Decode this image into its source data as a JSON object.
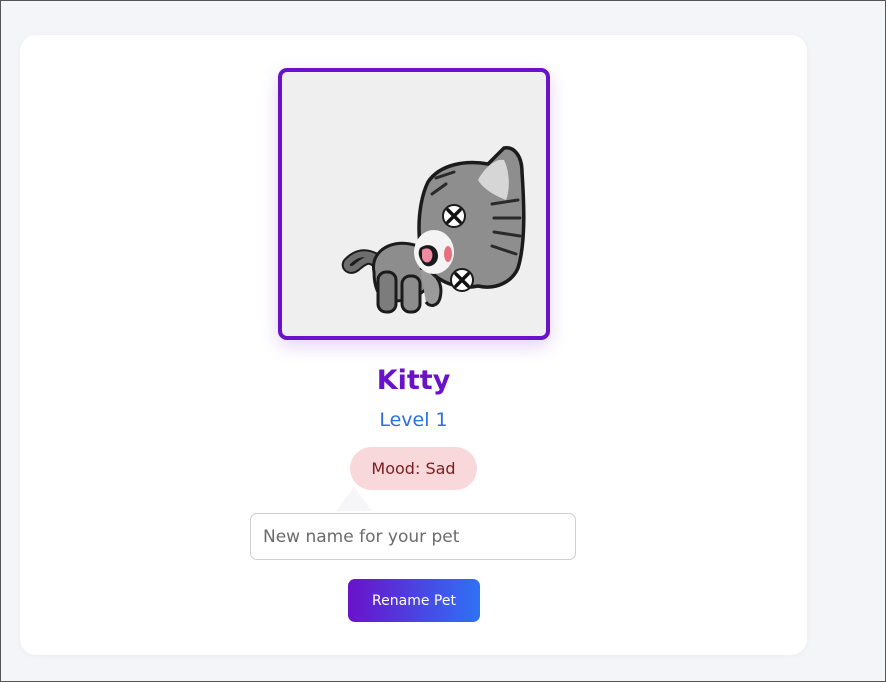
{
  "pet": {
    "name": "Kitty",
    "level": "Level 1",
    "mood": "Mood: Sad",
    "image": "sad-cat-icon"
  },
  "rename": {
    "placeholder": "New name for your pet",
    "value": "",
    "button_label": "Rename Pet"
  },
  "colors": {
    "accent": "#6a12c9",
    "level": "#2f6fe0",
    "mood_bg": "#f9d8dc",
    "mood_text": "#7a1d1d",
    "button_gradient_start": "#6a12c9",
    "button_gradient_end": "#2f72f5"
  }
}
